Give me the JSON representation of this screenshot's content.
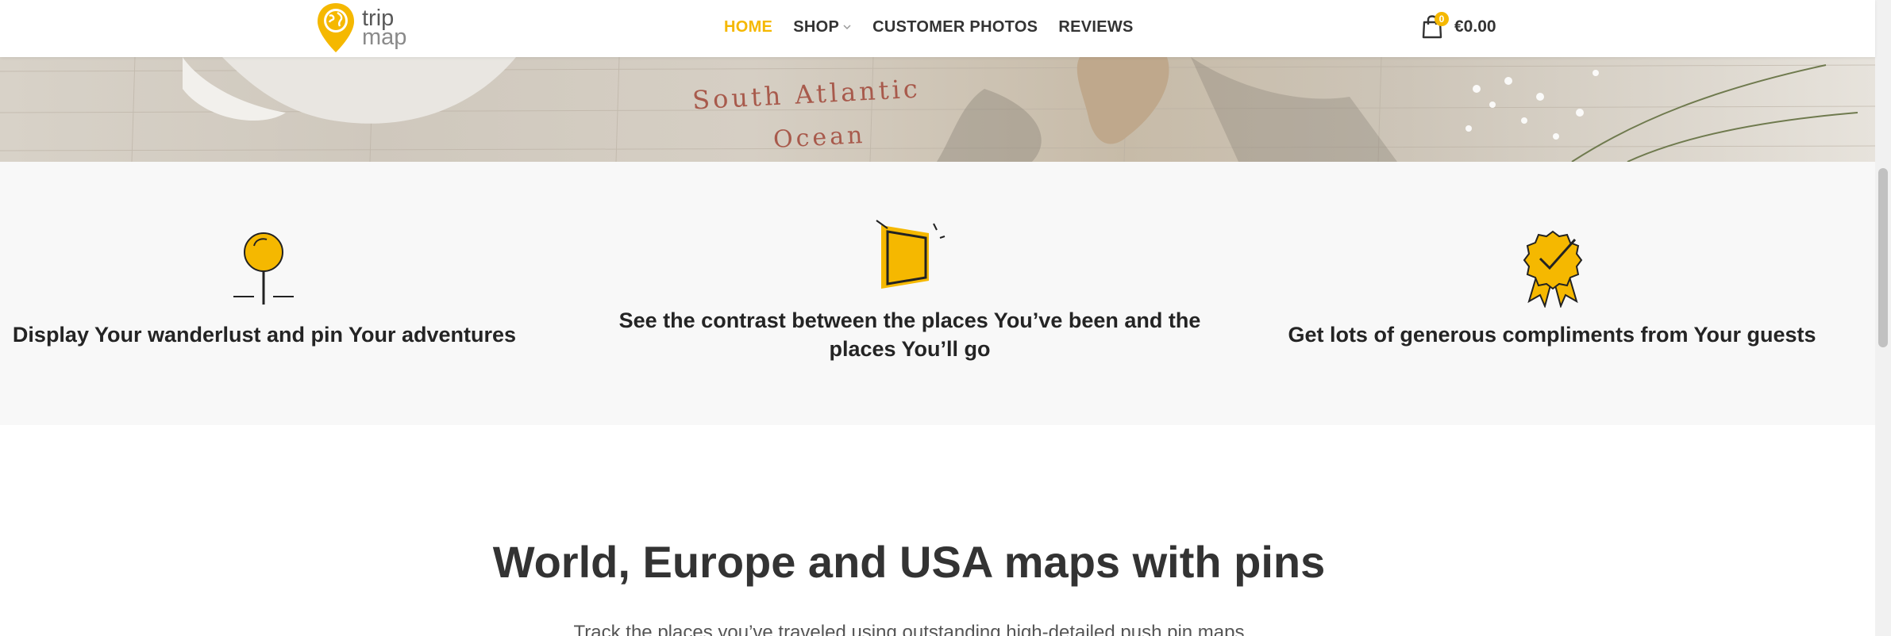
{
  "header": {
    "logo": {
      "line1": "trip",
      "line2": "map"
    },
    "nav": [
      {
        "label": "HOME",
        "active": true
      },
      {
        "label": "SHOP",
        "has_dropdown": true
      },
      {
        "label": "CUSTOMER PHOTOS"
      },
      {
        "label": "REVIEWS"
      }
    ],
    "cart": {
      "count": "0",
      "total": "€0.00"
    }
  },
  "banner": {
    "map_label_1": "South Atlantic",
    "map_label_2": "Ocean"
  },
  "features": [
    {
      "icon": "map-pin-icon",
      "title": "Display Your wanderlust and pin Your adventures"
    },
    {
      "icon": "map-frame-icon",
      "title_line1": "See the contrast between the places You’ve been and the",
      "title_line2": "places You’ll go"
    },
    {
      "icon": "award-badge-icon",
      "title": "Get lots of generous compliments from Your guests"
    }
  ],
  "section": {
    "heading": "World, Europe and USA maps with pins",
    "subtext": "Track the places you’ve traveled using outstanding high-detailed push pin maps"
  },
  "colors": {
    "accent": "#f5b800",
    "text": "#242424",
    "feature_bg": "#f8f8f8"
  }
}
